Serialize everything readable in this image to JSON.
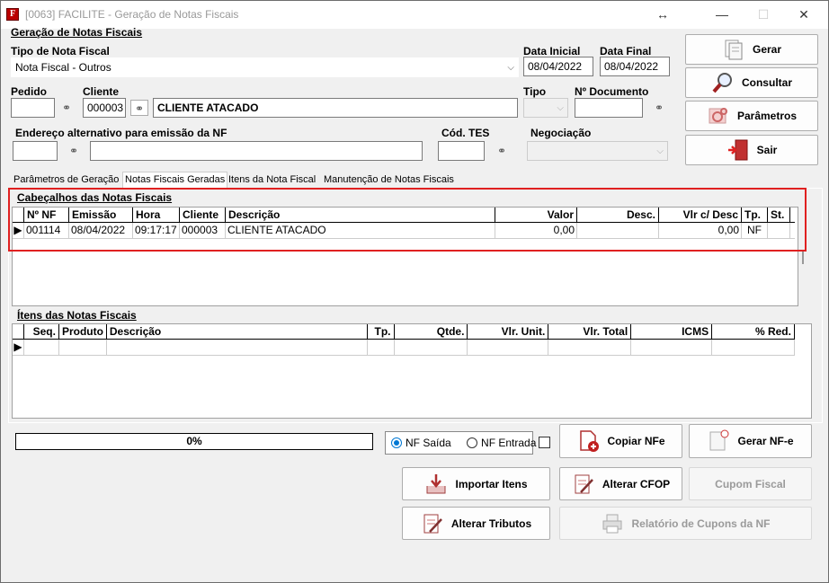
{
  "window": {
    "title": "[0063] FACILITE - Geração de Notas Fiscais",
    "app_icon": "F",
    "move_glyph": "↔",
    "minimize_glyph": "—",
    "maximize_glyph": "☐",
    "close_glyph": "✕"
  },
  "header": {
    "group_title": "Geração de Notas Fiscais",
    "tipo_label": "Tipo de Nota Fiscal",
    "tipo_value": "Nota Fiscal - Outros",
    "data_inicial_label": "Data Inicial",
    "data_inicial_value": "08/04/2022",
    "data_final_label": "Data Final",
    "data_final_value": "08/04/2022",
    "pedido_label": "Pedido",
    "pedido_value": "",
    "cliente_label": "Cliente",
    "cliente_code": "000003",
    "cliente_name": "CLIENTE ATACADO",
    "tipo2_label": "Tipo",
    "tipo2_value": "",
    "documento_label": "Nº Documento",
    "documento_value": "",
    "endereco_label": "Endereço alternativo para emissão da NF",
    "endereco_code": "",
    "endereco_value": "",
    "codtes_label": "Cód. TES",
    "codtes_value": "",
    "negociacao_label": "Negociação",
    "negociacao_value": ""
  },
  "side_buttons": [
    {
      "label": "Gerar",
      "icon": "documents-icon"
    },
    {
      "label": "Consultar",
      "icon": "magnifier-icon"
    },
    {
      "label": "Parâmetros",
      "icon": "gears-icon"
    },
    {
      "label": "Sair",
      "icon": "exit-door-icon"
    }
  ],
  "tabs": [
    {
      "label": "Parâmetros de Geração"
    },
    {
      "label": "Notas Fiscais Geradas"
    },
    {
      "label": "Itens da Nota Fiscal"
    },
    {
      "label": "Manutenção de Notas Fiscais"
    }
  ],
  "headers_section": {
    "title": "Cabeçalhos das Notas Fiscais",
    "columns": [
      "Nº NF",
      "Emissão",
      "Hora",
      "Cliente",
      "Descrição",
      "Valor",
      "Desc.",
      "Vlr c/ Desc",
      "Tp.",
      "St."
    ],
    "rows": [
      [
        "001114",
        "08/04/2022",
        "09:17:17",
        "000003",
        "CLIENTE ATACADO",
        "0,00",
        "",
        "0,00",
        "NF",
        ""
      ]
    ],
    "row_indicator": "▶"
  },
  "items_section": {
    "title": "Ítens das Notas Fiscais",
    "columns": [
      "Seq.",
      "Produto",
      "Descrição",
      "Tp.",
      "Qtde.",
      "Vlr. Unit.",
      "Vlr. Total",
      "ICMS",
      "% Red."
    ],
    "row_indicator": "▶"
  },
  "footer": {
    "progress_text": "0%",
    "progress_value": 0,
    "radio_saida": "NF Saída",
    "radio_entrada": "NF Entrada",
    "copiar": "Copiar NFe",
    "gerar_nfe": "Gerar NF-e",
    "importar": "Importar Itens",
    "alterar_cfop": "Alterar CFOP",
    "cupom": "Cupom Fiscal",
    "alterar_tributos": "Alterar Tributos",
    "relatorio": "Relatório de Cupons da NF"
  },
  "colors": {
    "highlight": "#e02020",
    "accent": "#0078d4"
  }
}
